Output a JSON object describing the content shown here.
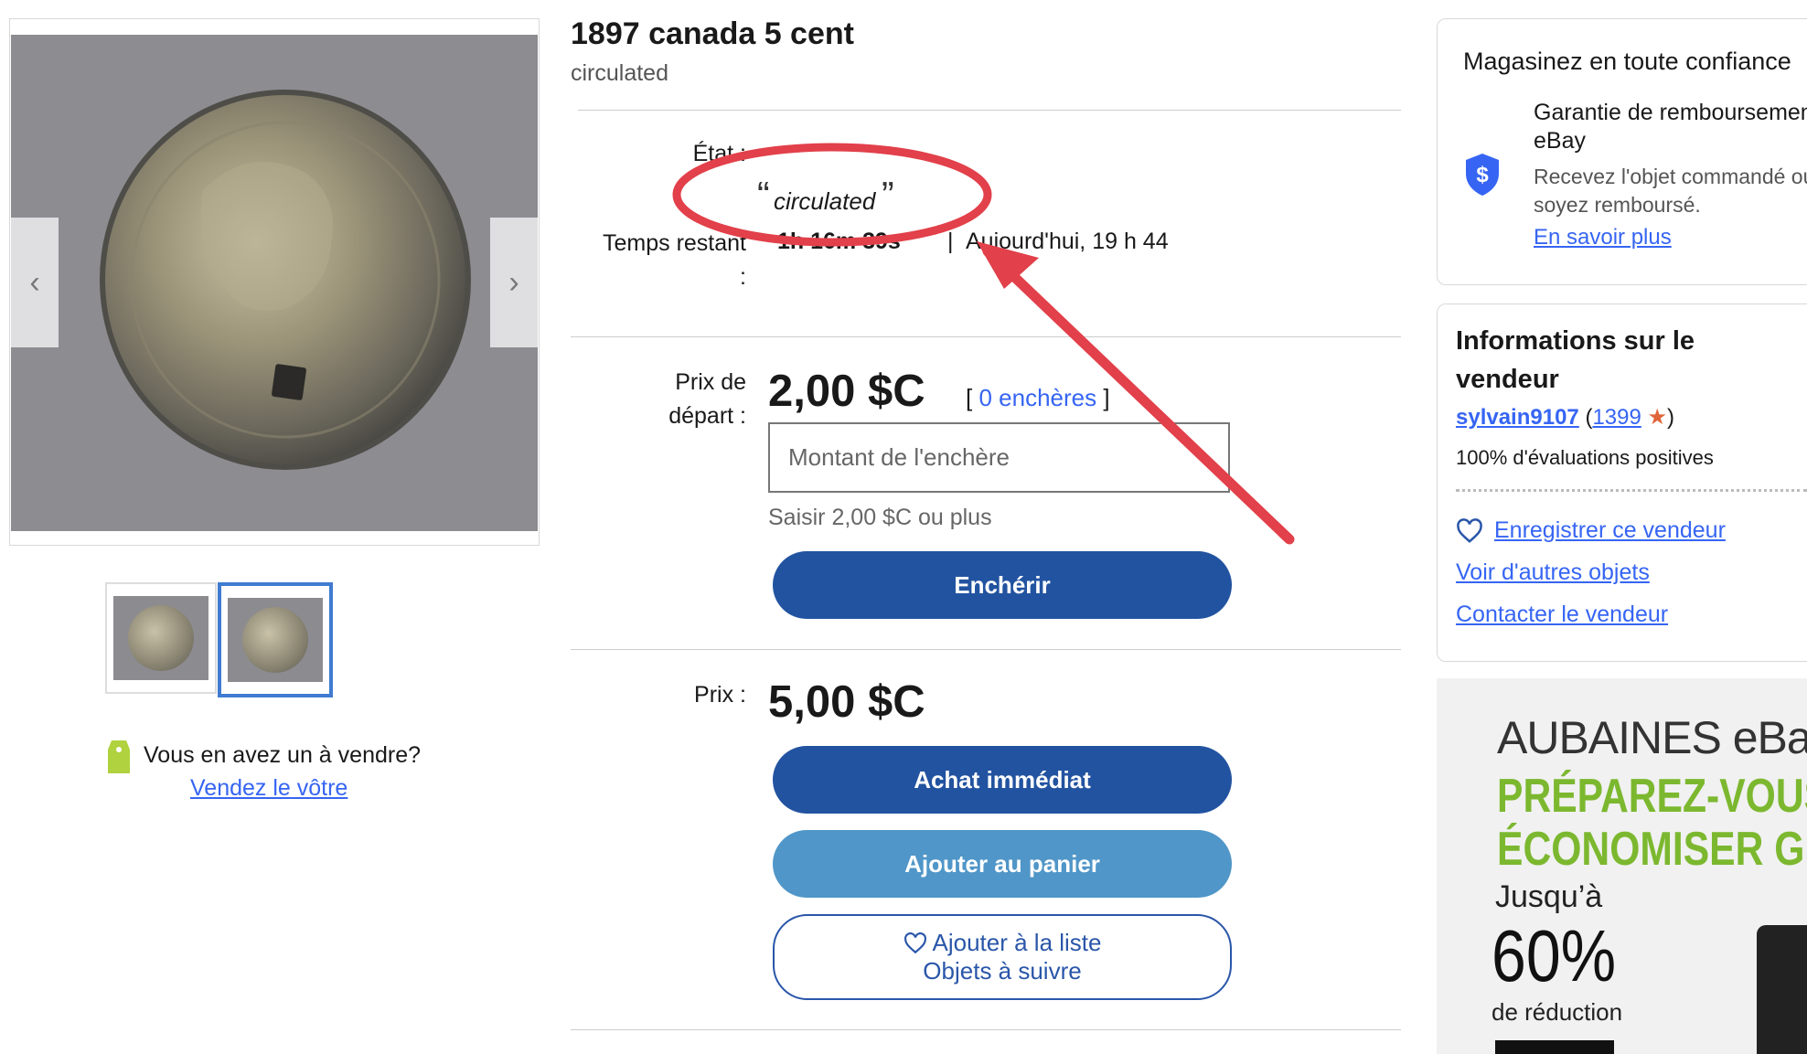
{
  "listing": {
    "title": "1897 canada 5 cent",
    "subtitle": "circulated"
  },
  "condition": {
    "label": "État :",
    "value": "circulated",
    "quote_open": "“",
    "quote_close": "”"
  },
  "time_left": {
    "label": "Temps restant :",
    "value": "1h 16m 39s",
    "separator": "|",
    "end_text": "Aujourd'hui, 19 h 44"
  },
  "auction": {
    "label": "Prix de départ :",
    "price": "2,00 $C",
    "bids_open": "[",
    "bids_link": "0 enchères",
    "bids_close": "]",
    "input_placeholder": "Montant de l'enchère",
    "hint": "Saisir 2,00 $C ou plus",
    "bid_button": "Enchérir"
  },
  "buy_now": {
    "label": "Prix :",
    "price": "5,00 $C",
    "buy_button": "Achat immédiat",
    "cart_button": "Ajouter au panier",
    "watch_line1": "Ajouter à la liste",
    "watch_line2": "Objets à suivre"
  },
  "sell_prompt": {
    "text": "Vous en avez un à vendre?",
    "link": "Vendez le vôtre"
  },
  "guarantee": {
    "heading": "Magasinez en toute confiance",
    "title_line1": "Garantie de remboursement",
    "title_line2": "eBay",
    "desc_line1": "Recevez l'objet commandé ou",
    "desc_line2": "soyez remboursé.",
    "link": "En savoir plus"
  },
  "seller": {
    "heading_line1": "Informations sur le",
    "heading_line2": "vendeur",
    "name": "sylvain9107",
    "paren_open": "(",
    "score": "1399",
    "paren_close": ")",
    "feedback": "100% d'évaluations positives",
    "save_link": "Enregistrer ce vendeur",
    "other_items_link": "Voir d'autres objets",
    "contact_link": "Contacter le vendeur"
  },
  "promo": {
    "brand": "AUBAINES eBay",
    "headline1": "PRÉPAREZ-VOUS À",
    "headline2": "ÉCONOMISER GROS",
    "upto": "Jusqu’à",
    "percent": "60%",
    "off": "de réduction"
  },
  "colors": {
    "link": "#3665f3",
    "primary_button": "#2253a0",
    "secondary_button": "#5096c8",
    "annotation": "#e2404a",
    "promo_green": "#7cb82f"
  }
}
